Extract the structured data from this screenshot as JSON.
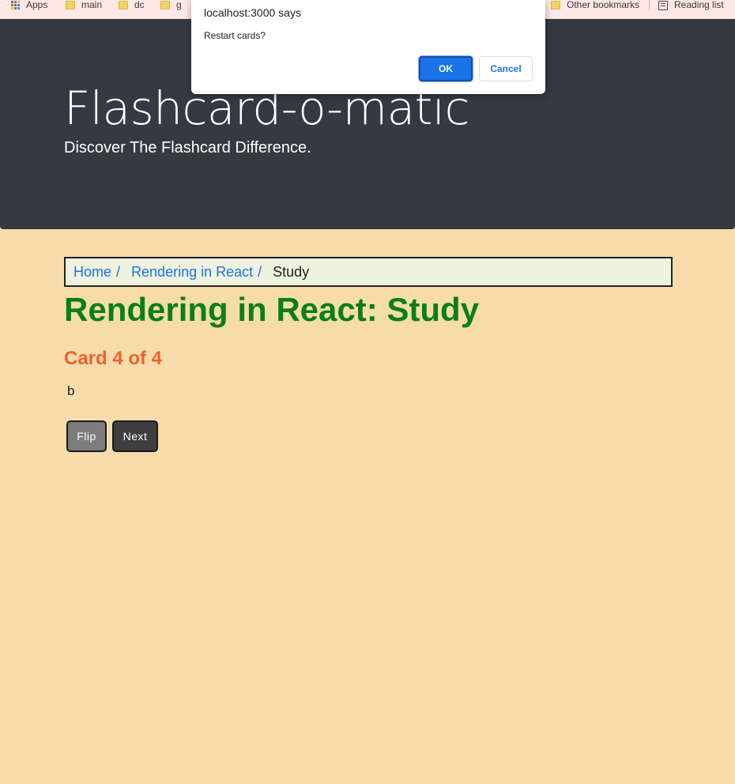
{
  "bookmarks": {
    "apps_label": "Apps",
    "items": [
      "main",
      "dc",
      "g"
    ],
    "other_label": "Other bookmarks",
    "reading_label": "Reading list"
  },
  "header": {
    "title": "Flashcard-o-matic",
    "tagline": "Discover The Flashcard Difference."
  },
  "breadcrumb": {
    "home": "Home",
    "deck": "Rendering in React",
    "separator": "/",
    "current": "Study"
  },
  "study": {
    "heading": "Rendering in React: Study",
    "card_count": "Card 4 of 4",
    "card_text": "b",
    "flip_label": "Flip",
    "next_label": "Next"
  },
  "dialog": {
    "title": "localhost:3000 says",
    "message": "Restart cards?",
    "ok_label": "OK",
    "cancel_label": "Cancel"
  },
  "colors": {
    "page_background": "#f6dcab",
    "header_background": "#343a40",
    "heading_green": "#0c7d1a",
    "card_count_orange": "#f0622c",
    "link_blue": "#1a73e8"
  }
}
